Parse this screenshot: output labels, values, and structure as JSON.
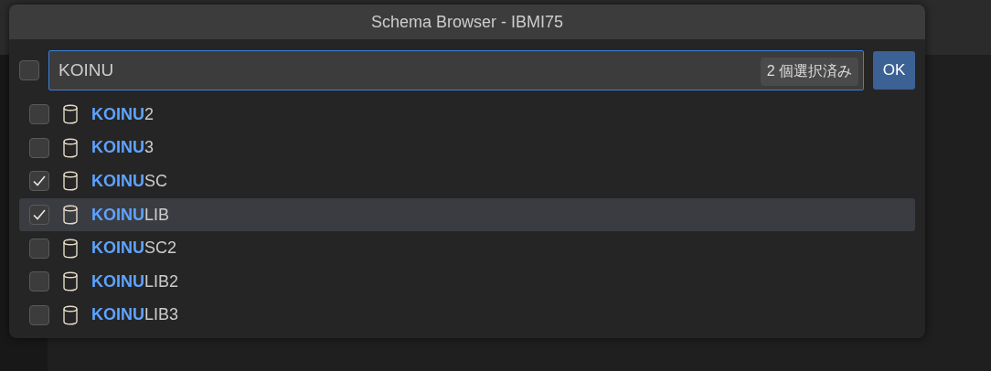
{
  "window": {
    "title": "Schema Browser - IBMI75"
  },
  "select_all": {
    "checked": false
  },
  "search": {
    "value": "KOINU",
    "badge": "2 個選択済み"
  },
  "ok_button": "OK",
  "items": [
    {
      "label": "**KOINU**2",
      "checked": false,
      "selected": false
    },
    {
      "label": "**KOINU**3",
      "checked": false,
      "selected": false
    },
    {
      "label": "**KOINU**SC",
      "checked": true,
      "selected": false
    },
    {
      "label": "**KOINU**LIB",
      "checked": true,
      "selected": true
    },
    {
      "label": "**KOINU**SC2",
      "checked": false,
      "selected": false
    },
    {
      "label": "**KOINU**LIB2",
      "checked": false,
      "selected": false
    },
    {
      "label": "**KOINU**LIB3",
      "checked": false,
      "selected": false
    }
  ]
}
